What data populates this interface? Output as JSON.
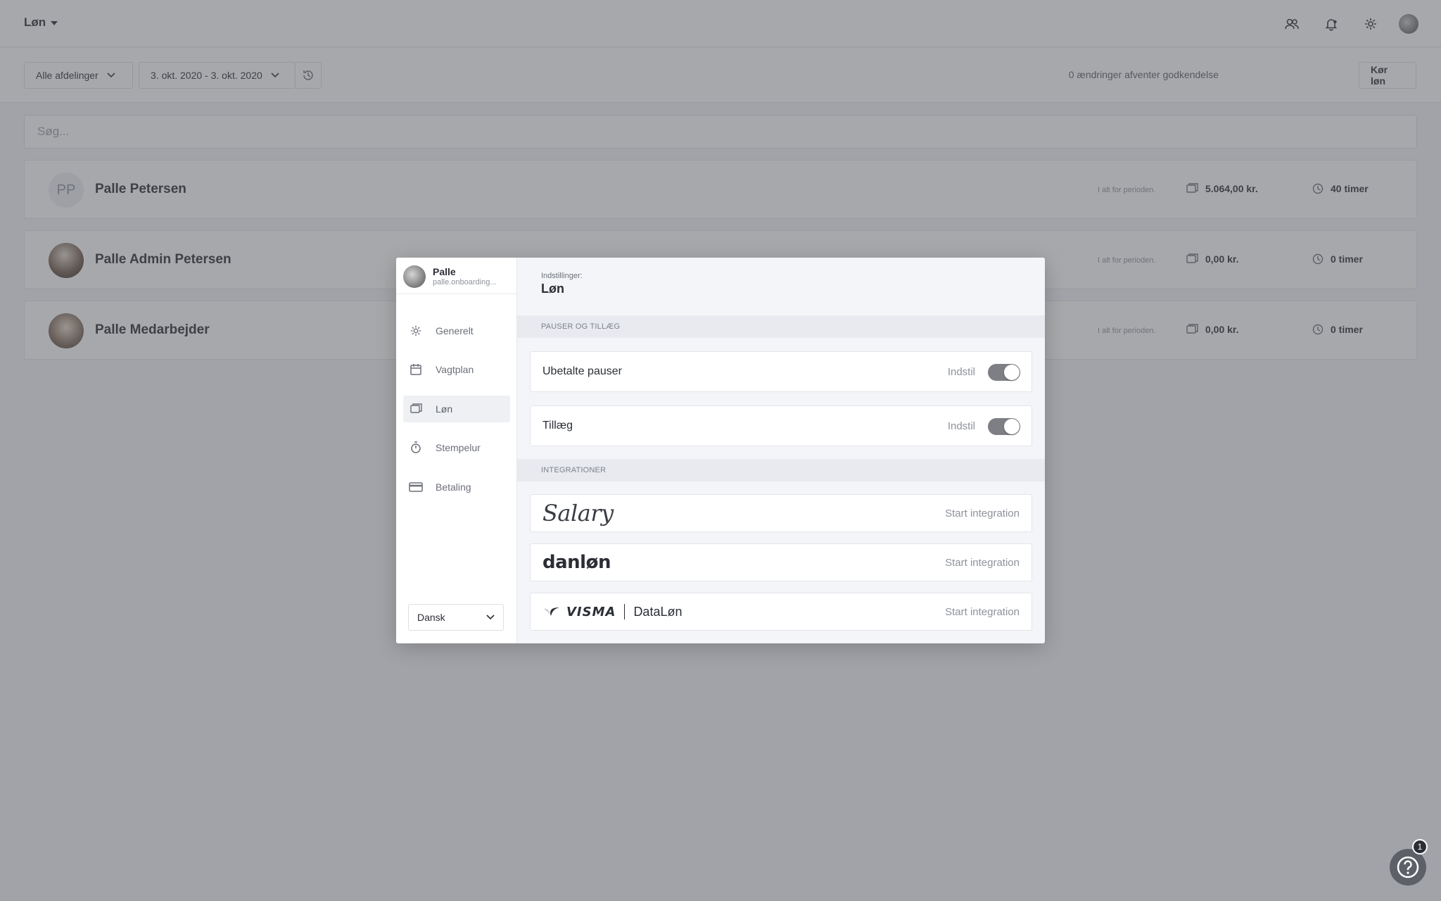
{
  "app": {
    "title": "Løn",
    "top_icons": [
      "users-icon",
      "bell-icon",
      "gear-icon",
      "avatar"
    ]
  },
  "toolbar": {
    "department_select": "Alle afdelinger",
    "date_range": "3. okt. 2020 - 3. okt. 2020",
    "history_icon": "history-icon",
    "pending_text": "0 ændringer afventer godkendelse",
    "run_button": "Kør løn"
  },
  "search": {
    "placeholder": "Søg..."
  },
  "employees": [
    {
      "initials": "PP",
      "name": "Palle Petersen",
      "period_label": "I alt for perioden.",
      "amount": "5.064,00 kr.",
      "hours": "40 timer"
    },
    {
      "initials": "",
      "name": "Palle Admin Petersen",
      "period_label": "I alt for perioden.",
      "amount": "0,00 kr.",
      "hours": "0 timer"
    },
    {
      "initials": "",
      "name": "Palle Medarbejder",
      "period_label": "I alt for perioden.",
      "amount": "0,00 kr.",
      "hours": "0 timer"
    }
  ],
  "modal": {
    "user": {
      "name": "Palle",
      "email": "palle.onboarding..."
    },
    "nav": [
      {
        "label": "Generelt",
        "icon": "gear-icon",
        "active": false
      },
      {
        "label": "Vagtplan",
        "icon": "calendar-icon",
        "active": false
      },
      {
        "label": "Løn",
        "icon": "coins-icon",
        "active": true
      },
      {
        "label": "Stempelur",
        "icon": "stopwatch-icon",
        "active": false
      },
      {
        "label": "Betaling",
        "icon": "credit-card-icon",
        "active": false
      }
    ],
    "language": "Dansk",
    "header": {
      "subtitle": "Indstillinger:",
      "title": "Løn"
    },
    "sections": {
      "breaks": "PAUSER OG TILLÆG",
      "integrations": "INTEGRATIONER"
    },
    "settings": [
      {
        "label": "Ubetalte pauser",
        "link": "Indstil",
        "enabled": true
      },
      {
        "label": "Tillæg",
        "link": "Indstil",
        "enabled": true
      }
    ],
    "integrations": [
      {
        "logo_text": "Salary",
        "action": "Start integration"
      },
      {
        "logo_text": "danløn",
        "action": "Start integration"
      },
      {
        "logo_text": "VISMA",
        "logo_text_2": "DataLøn",
        "action": "Start integration"
      }
    ]
  },
  "help": {
    "badge": "1",
    "icon": "question-icon"
  },
  "colors": {
    "overlay": "#505258",
    "toggle_on": "#7d7f85",
    "active_nav_bg": "#eef0f4"
  }
}
